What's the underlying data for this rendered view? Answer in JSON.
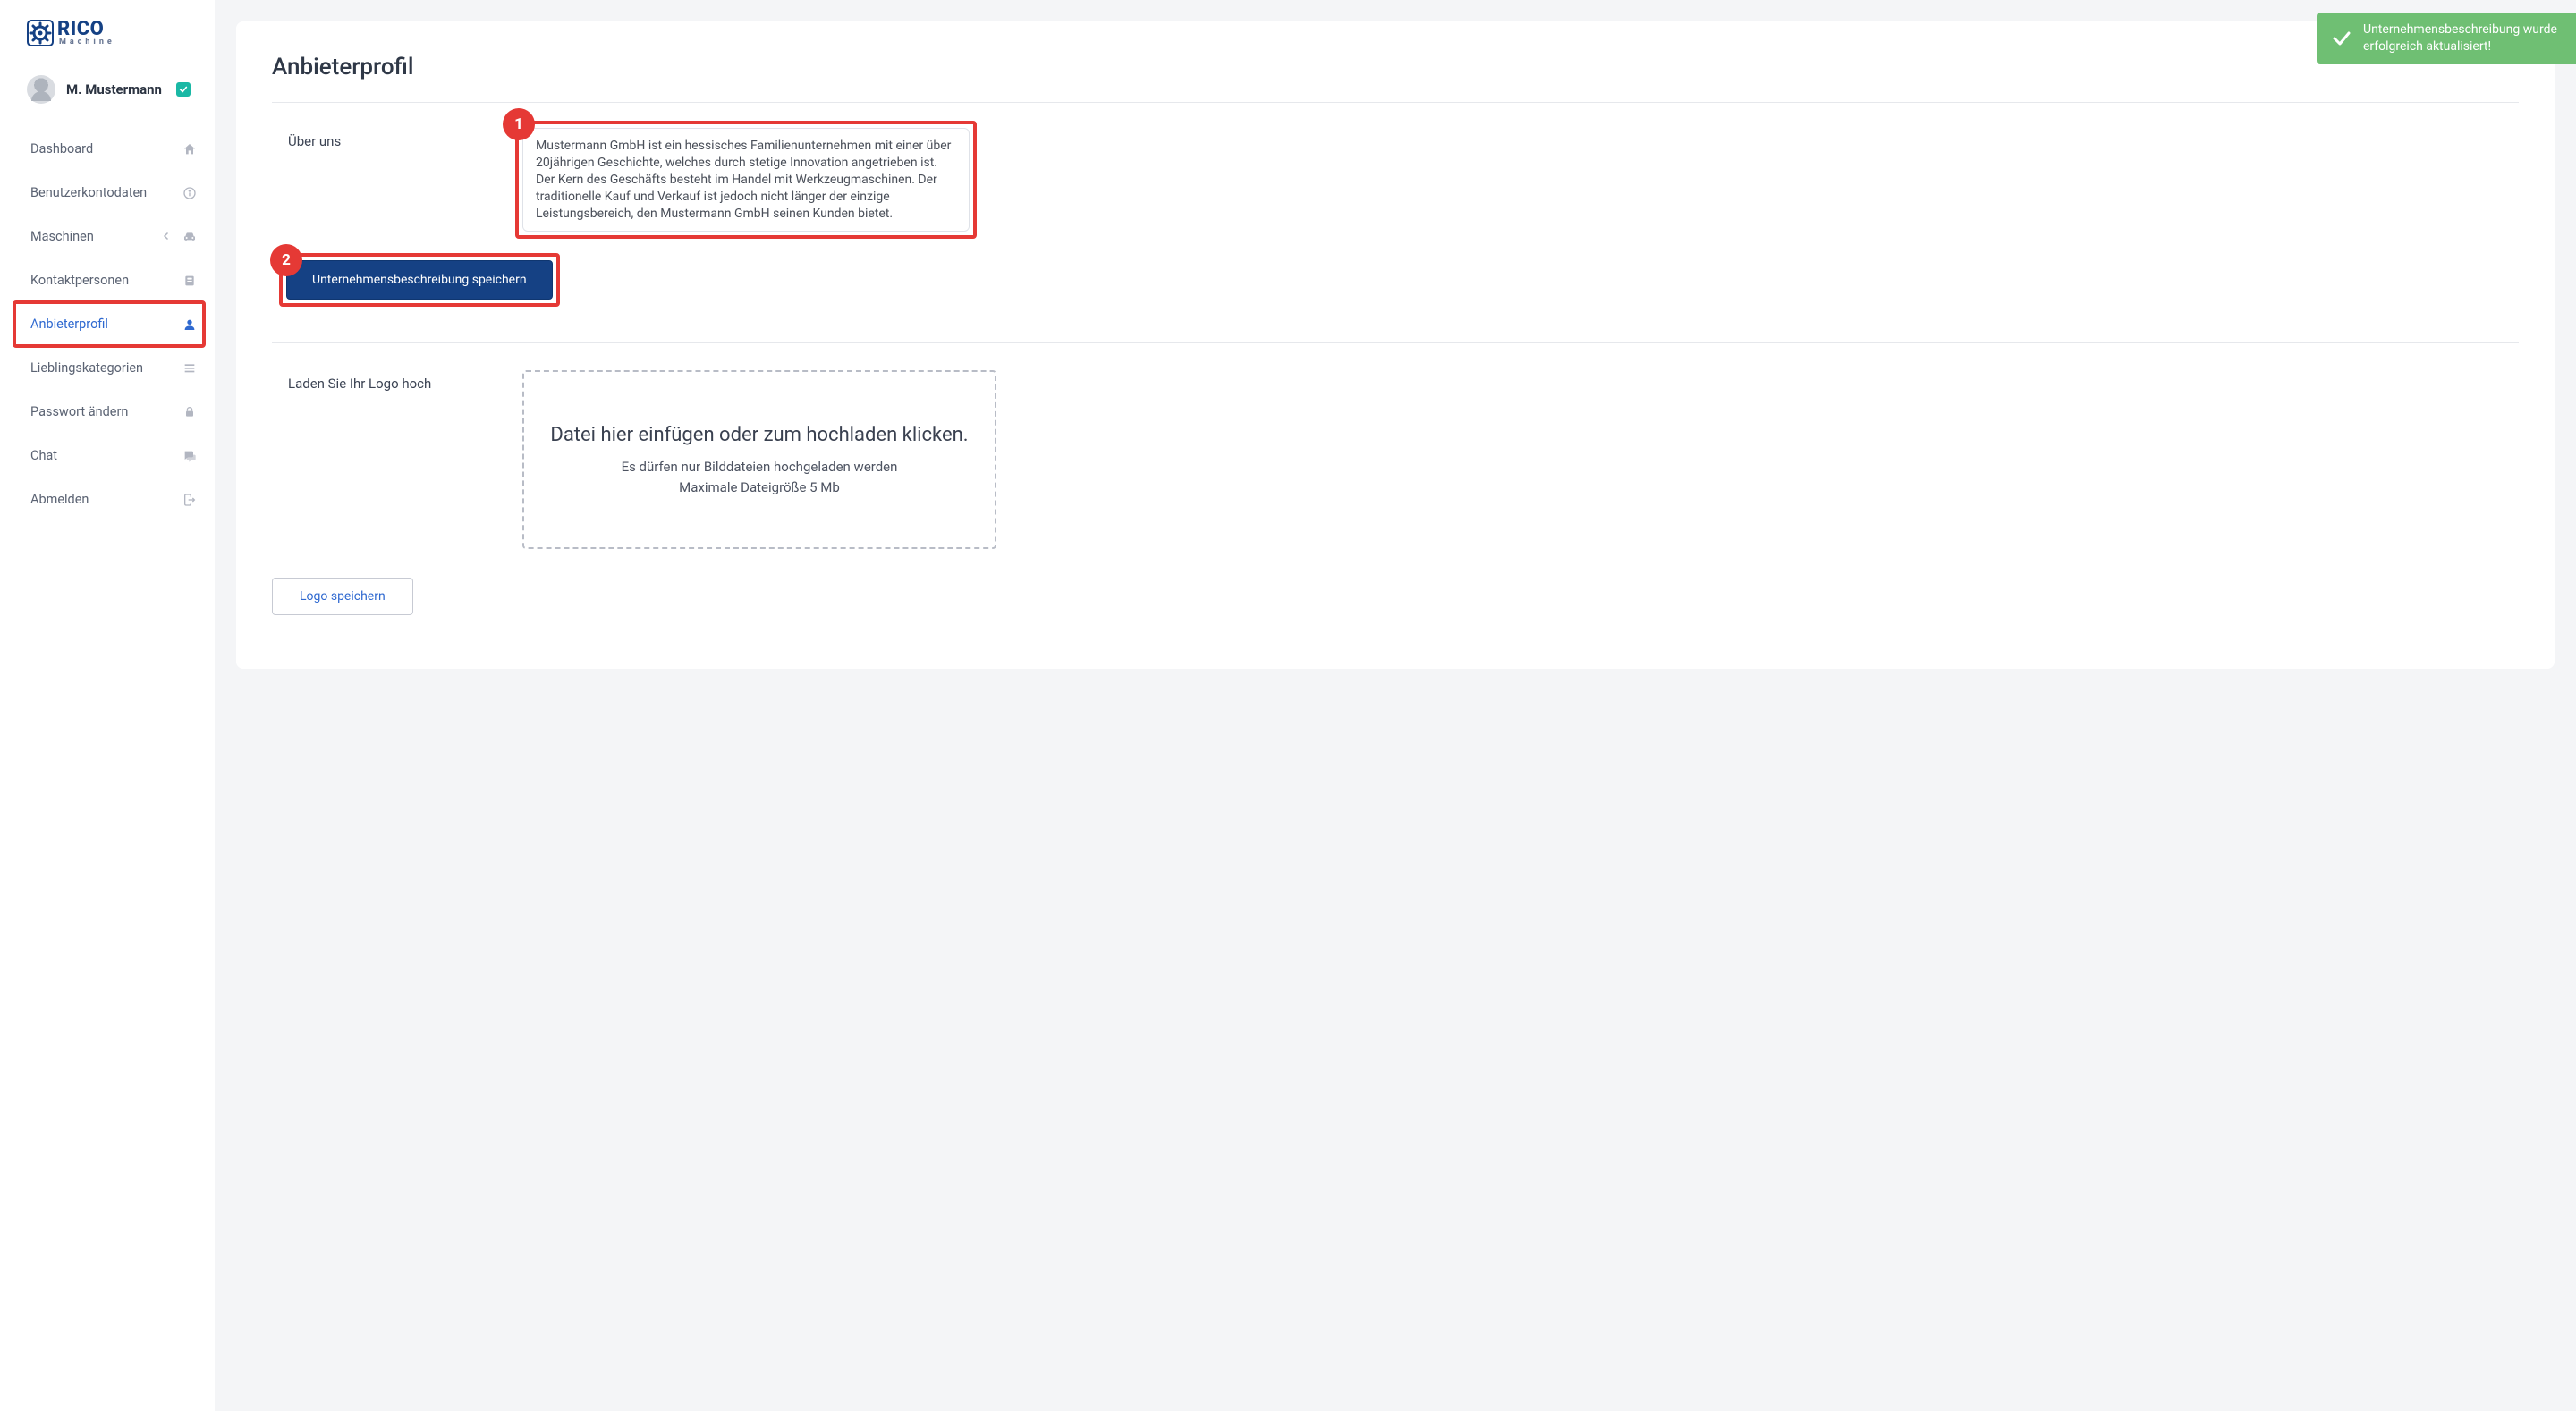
{
  "brand": {
    "top": "RICO",
    "bottom": "Machine"
  },
  "user": {
    "name": "M. Mustermann"
  },
  "nav": {
    "dashboard": "Dashboard",
    "account": "Benutzerkontodaten",
    "machines": "Maschinen",
    "contacts": "Kontaktpersonen",
    "provider_profile": "Anbieterprofil",
    "fav_categories": "Lieblingskategorien",
    "change_password": "Passwort ändern",
    "chat": "Chat",
    "logout": "Abmelden"
  },
  "page": {
    "title": "Anbieterprofil",
    "about_label": "Über uns",
    "about_text": "Mustermann GmbH ist ein hessisches Familienunternehmen mit einer über 20jährigen Geschichte, welches durch stetige Innovation angetrieben ist. Der Kern des Geschäfts besteht im Handel mit Werkzeugmaschinen. Der traditionelle Kauf und Verkauf ist jedoch nicht länger der einzige Leistungsbereich, den Mustermann GmbH seinen Kunden bietet.",
    "save_description_btn": "Unternehmensbeschreibung speichern",
    "upload_label": "Laden Sie Ihr Logo hoch",
    "dropzone_title": "Datei hier einfügen oder zum hochladen klicken.",
    "dropzone_sub1": "Es dürfen nur Bilddateien hochgeladen werden",
    "dropzone_sub2": "Maximale Dateigröße 5 Mb",
    "save_logo_btn": "Logo speichern"
  },
  "callouts": {
    "one": "1",
    "two": "2"
  },
  "toast": {
    "text": "Unternehmensbeschreibung wurde erfolgreich aktualisiert!"
  }
}
